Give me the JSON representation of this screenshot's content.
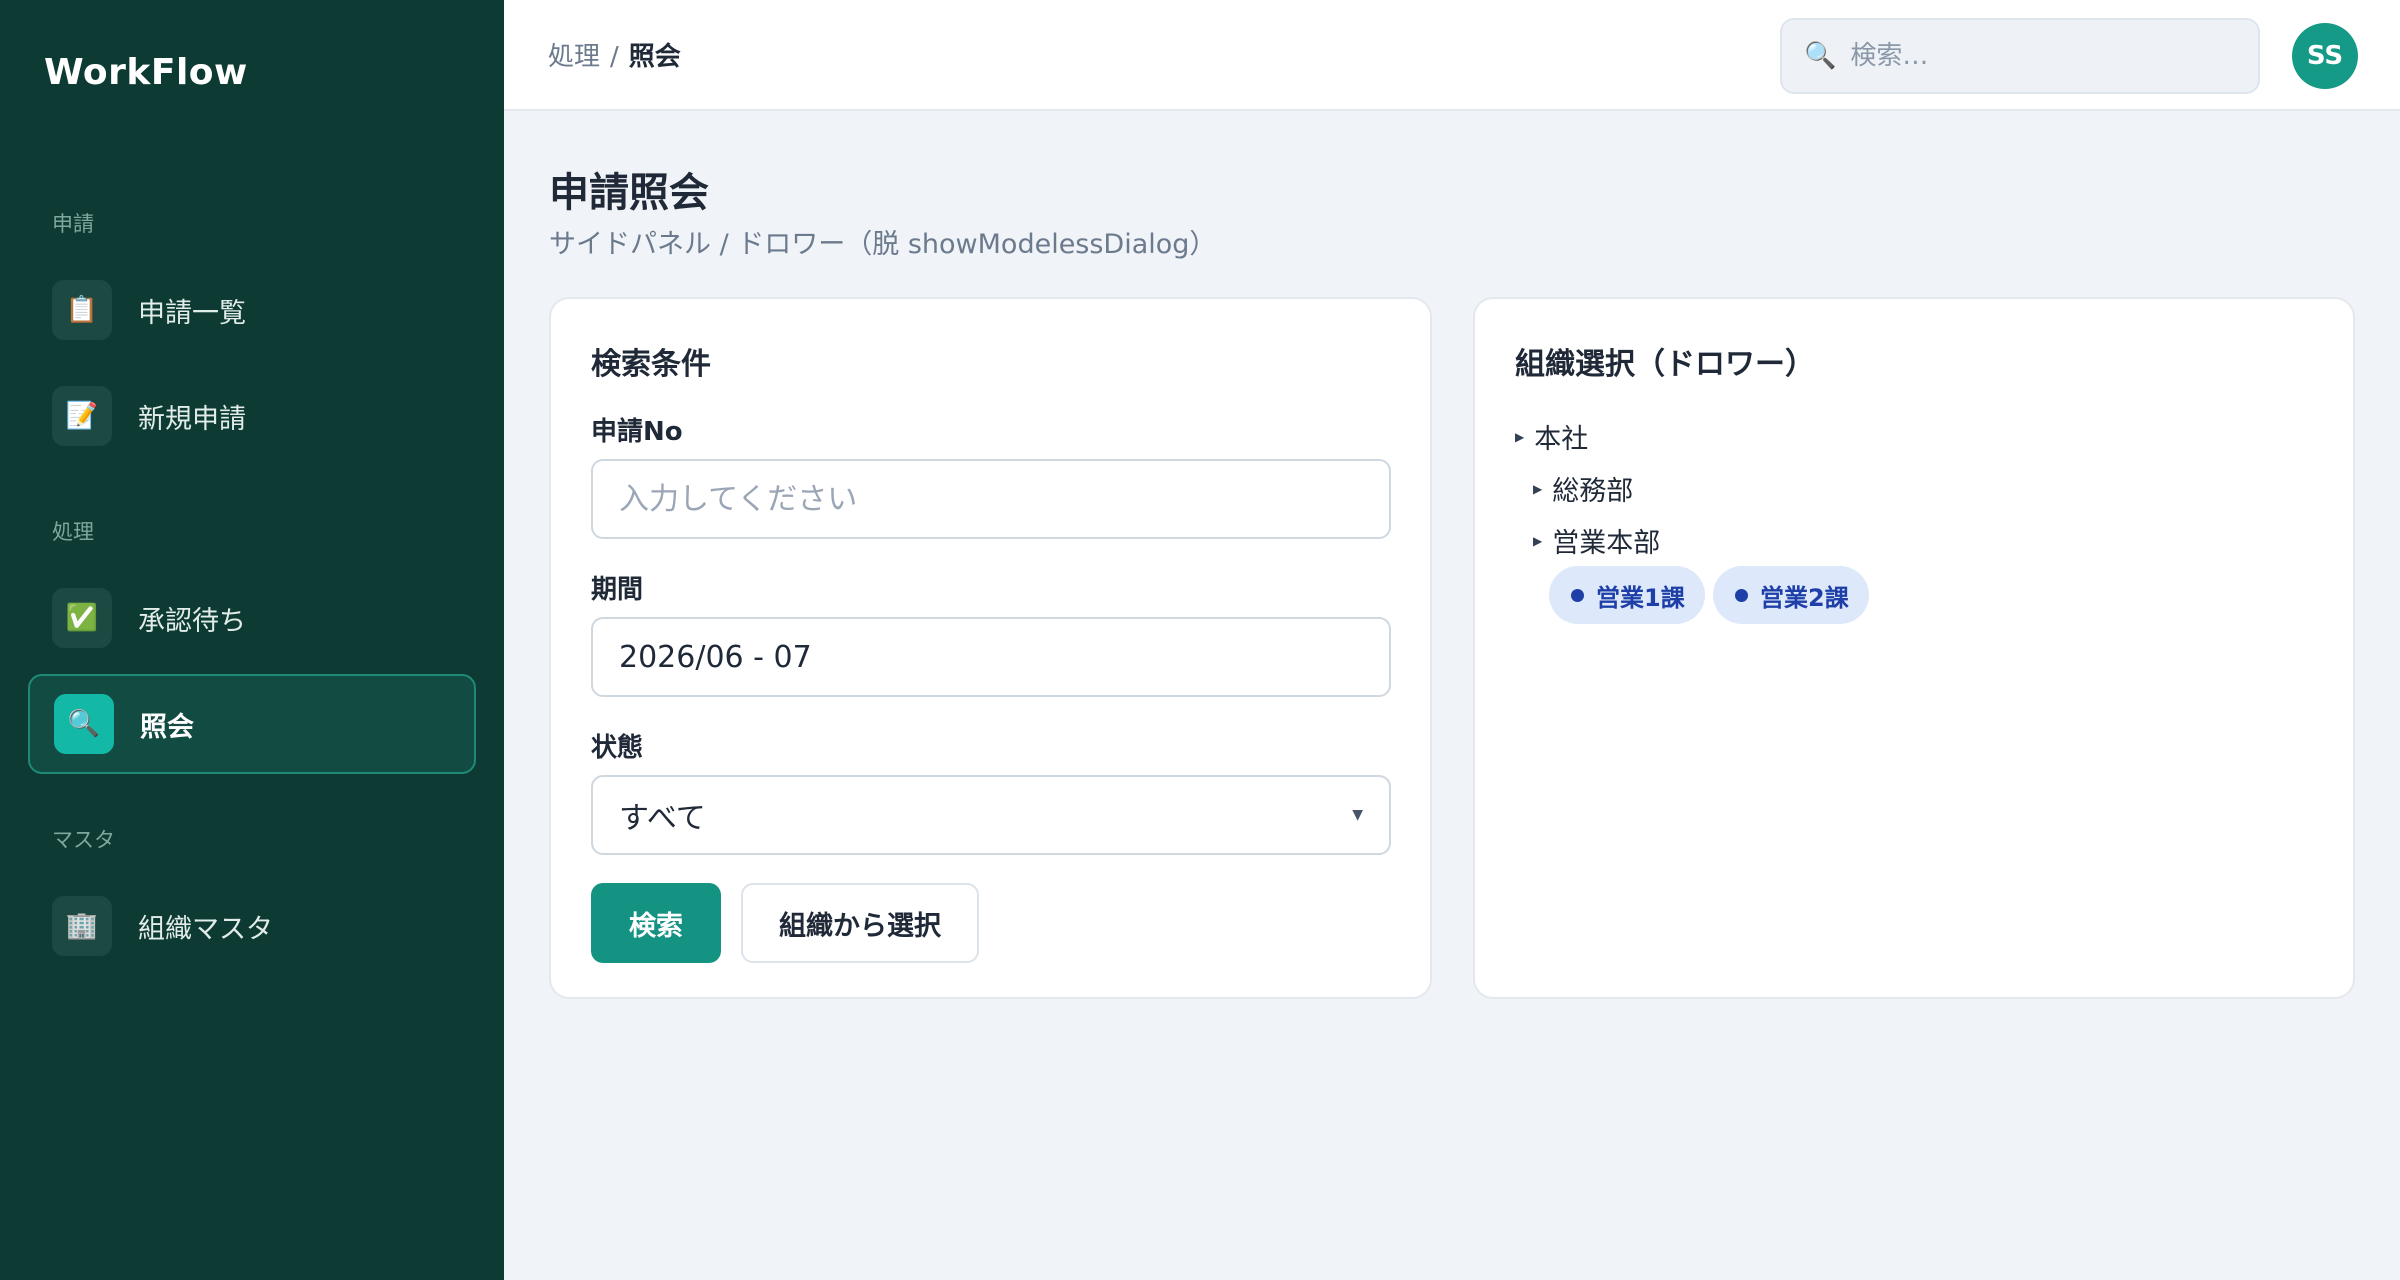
{
  "app": {
    "brand": "WorkFlow"
  },
  "sidebar": {
    "sections": [
      {
        "label": "申請"
      },
      {
        "label": "処理"
      },
      {
        "label": "マスタ"
      }
    ],
    "items": [
      {
        "label": "申請一覧",
        "icon": "📋",
        "icon_name": "clipboard-icon"
      },
      {
        "label": "新規申請",
        "icon": "📝",
        "icon_name": "memo-icon"
      },
      {
        "label": "承認待ち",
        "icon": "✅",
        "icon_name": "check-icon"
      },
      {
        "label": "照会",
        "icon": "🔍",
        "icon_name": "search-icon",
        "active": true
      },
      {
        "label": "組織マスタ",
        "icon": "🏢",
        "icon_name": "building-icon"
      }
    ]
  },
  "header": {
    "breadcrumb_parent": "処理",
    "breadcrumb_sep": "/",
    "breadcrumb_current": "照会",
    "search_placeholder": "検索…",
    "avatar_initials": "SS"
  },
  "page": {
    "title": "申請照会",
    "subtitle": "サイドパネル / ドロワー（脱 showModelessDialog）"
  },
  "search_form": {
    "title": "検索条件",
    "application_no_label": "申請No",
    "application_no_placeholder": "入力してください",
    "application_no_value": "",
    "period_label": "期間",
    "period_value": "2026/06 - 07",
    "status_label": "状態",
    "status_value": "すべて",
    "search_button": "検索",
    "org_select_button": "組織から選択"
  },
  "org_drawer": {
    "title": "組織選択（ドロワー）",
    "tree": {
      "root": "本社",
      "children": [
        "総務部",
        "営業本部"
      ],
      "selected_chips": [
        "営業1課",
        "営業2課"
      ]
    }
  },
  "colors": {
    "sidebar_bg": "#0d3b34",
    "accent": "#149383",
    "chip_bg": "#dde8fb",
    "chip_text": "#1e3fa8"
  }
}
